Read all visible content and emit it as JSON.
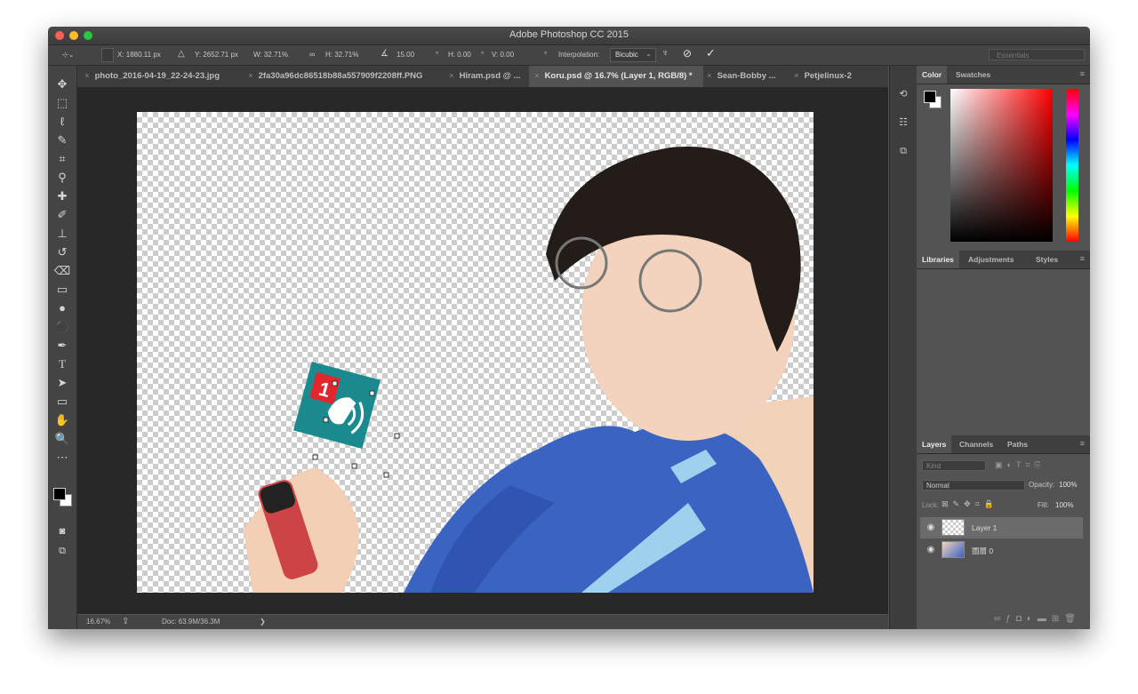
{
  "app": {
    "title": "Adobe Photoshop CC 2015"
  },
  "options": {
    "x": "X: 1880.11 px",
    "y": "Y: 2652.71 px",
    "w": "W: 32.71%",
    "h": "H: 32.71%",
    "angle": "15.00",
    "angle_unit": "°",
    "skew_h": "H: 0.00",
    "skew_v": "V: 0.00",
    "interpolation_label": "Interpolation:",
    "interpolation_value": "Bicubic",
    "workspace": "Essentials"
  },
  "tabs": [
    {
      "label": "photo_2016-04-19_22-24-23.jpg"
    },
    {
      "label": "2fa30a96dc86518b88a557909f2208ff.PNG"
    },
    {
      "label": "Hiram.psd @ ..."
    },
    {
      "label": "Koru.psd @ 16.7% (Layer 1, RGB/8) *",
      "active": true
    },
    {
      "label": "Sean-Bobby ..."
    },
    {
      "label": "Petjelinux-2"
    }
  ],
  "tab_overflow": ">>",
  "tab_close": "×",
  "status": {
    "zoom": "16.67%",
    "doc": "Doc: 63.9M/36.3M",
    "arrow": "❯"
  },
  "color_panel": {
    "tabs": [
      "Color",
      "Swatches"
    ]
  },
  "libraries_panel": {
    "tabs": [
      "Libraries",
      "Adjustments",
      "Styles"
    ]
  },
  "layers_panel": {
    "tabs": [
      "Layers",
      "Channels",
      "Paths"
    ],
    "filter_placeholder": "Kind",
    "blend_mode": "Normal",
    "opacity_label": "Opacity:",
    "opacity_value": "100%",
    "lock_label": "Lock:",
    "fill_label": "Fill:",
    "fill_value": "100%",
    "layers": [
      {
        "name": "Layer 1",
        "selected": true
      },
      {
        "name": "圖層 0",
        "selected": false
      }
    ]
  },
  "sticker": {
    "number": "1"
  },
  "icons": {
    "menu": "≡",
    "eye": "👁",
    "chevron": "⌄"
  },
  "colors": {
    "accent_teal": "#1a8a8f",
    "badge_red": "#e3262c"
  }
}
